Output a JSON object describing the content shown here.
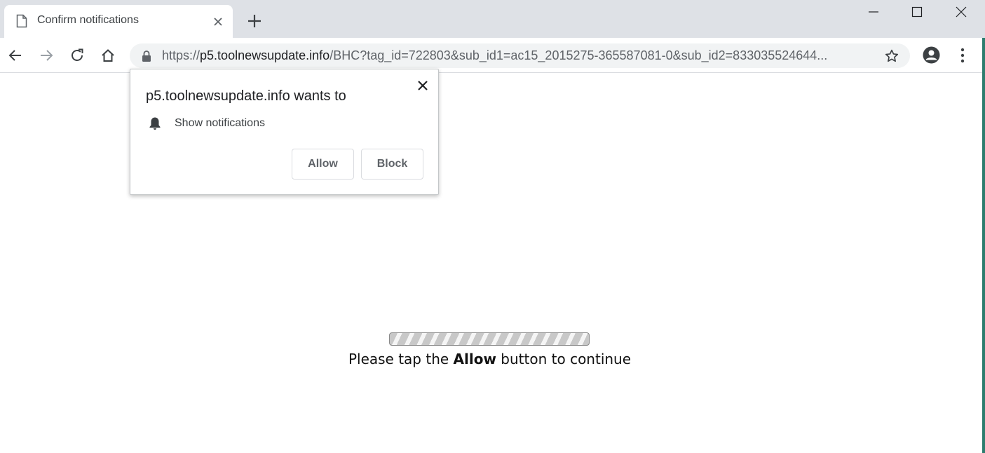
{
  "tab": {
    "title": "Confirm notifications",
    "favicon_icon": "page-icon",
    "close_icon": "close-icon"
  },
  "new_tab_icon": "plus-icon",
  "window_controls": {
    "minimize_icon": "minimize-icon",
    "maximize_icon": "maximize-icon",
    "close_icon": "close-icon"
  },
  "toolbar": {
    "back_icon": "arrow-left-icon",
    "forward_icon": "arrow-right-icon",
    "reload_icon": "reload-icon",
    "home_icon": "home-icon",
    "star_icon": "star-icon",
    "profile_icon": "account-circle-icon",
    "menu_icon": "more-vertical-icon"
  },
  "omnibox": {
    "lock_icon": "lock-icon",
    "url_scheme": "https://",
    "url_host": "p5.toolnewsupdate.info",
    "url_path": "/BHC?tag_id=722803&sub_id1=ac15_2015275-365587081-0&sub_id2=833035524644..."
  },
  "permission_popup": {
    "title": "p5.toolnewsupdate.info wants to",
    "permission_label": "Show notifications",
    "permission_icon": "bell-icon",
    "allow_label": "Allow",
    "block_label": "Block",
    "close_icon": "close-icon"
  },
  "page": {
    "progress": 1.0,
    "message_before": "Please tap the ",
    "message_bold": "Allow",
    "message_after": " button to continue"
  },
  "colors": {
    "tabstrip_bg": "#dee1e6",
    "omnibox_bg": "#f1f3f4",
    "desktop_edge": "#2e7d6e"
  }
}
